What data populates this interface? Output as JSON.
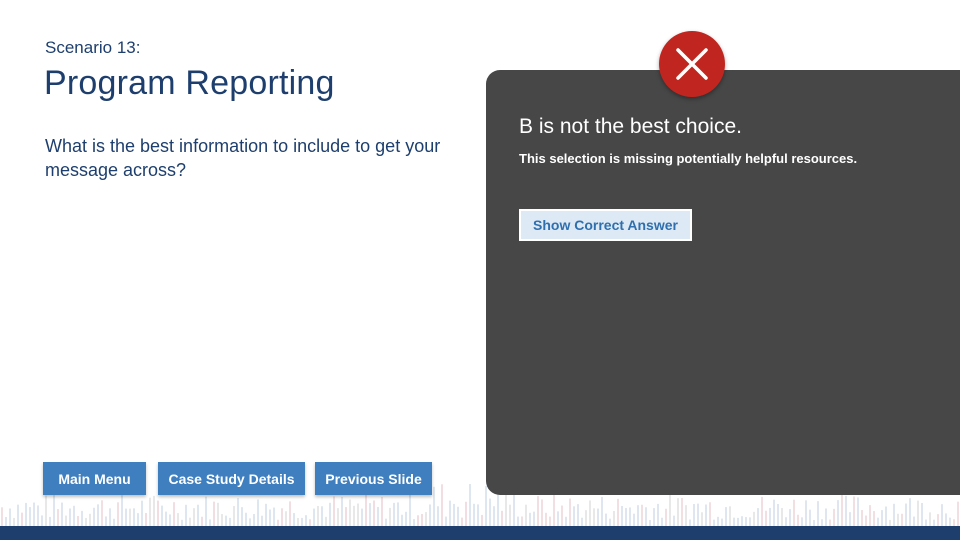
{
  "scenario": {
    "label": "Scenario 13:",
    "title": "Program Reporting",
    "question": "What is the best information to include to get your message across?"
  },
  "feedback": {
    "heading": "B is not the best choice.",
    "body": "This selection is missing potentially helpful resources.",
    "show_answer_label": "Show Correct Answer",
    "status_icon": "incorrect-x-icon",
    "status_color": "#c0261f"
  },
  "nav": {
    "main_menu": "Main Menu",
    "case_study": "Case Study Details",
    "previous": "Previous Slide"
  },
  "colors": {
    "brand_navy": "#1e3f6d",
    "button_blue": "#3f7fbf",
    "panel_gray": "#474747"
  }
}
